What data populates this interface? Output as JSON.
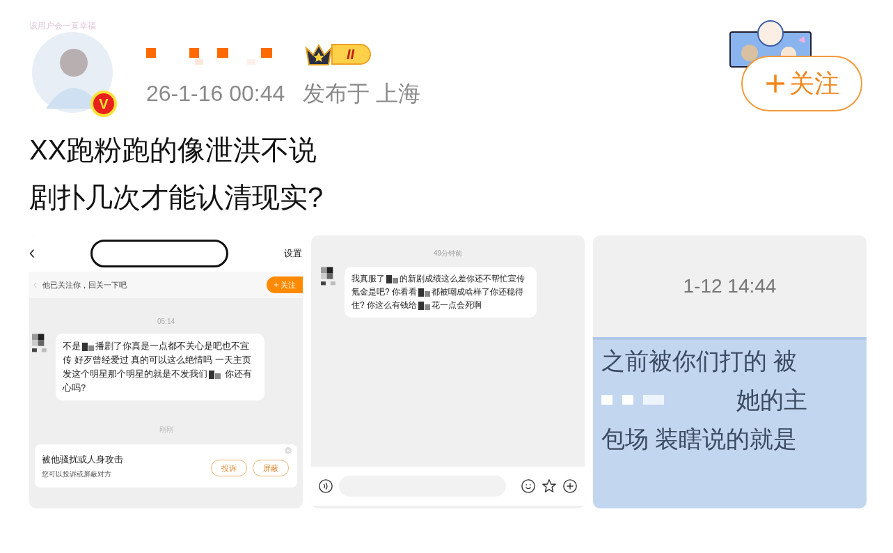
{
  "post": {
    "avatar_frame_text": "该用户会一直幸福",
    "verified_mark": "V",
    "level_badge": "II",
    "timestamp": "26-1-16 00:44",
    "location": "发布于 上海",
    "follow_label": "关注",
    "body": [
      "XX跑粉跑的像泄洪不说",
      "剧扑几次才能认清现实?"
    ]
  },
  "images": [
    {
      "kind": "dm_screen",
      "settings": "设置",
      "banner": "他已关注你，回关一下吧",
      "banner_follow": "关注",
      "time": "05:14",
      "message": [
        {
          "kind": "text",
          "text": "不是"
        },
        {
          "kind": "mosaic"
        },
        {
          "kind": "text",
          "text": "播剧了你真是一点都不关心是吧也不宣传 好歹曾经爱过 真的可以这么绝情吗 一天主页发这个明星那个明星的就是不发我们"
        },
        {
          "kind": "mosaic"
        },
        {
          "kind": "text",
          "text": " 你还有心吗?"
        }
      ],
      "time2": "刚刚",
      "notice_title": "被他骚扰或人身攻击",
      "notice_sub": "您可以投诉或屏蔽对方",
      "notice_buttons": [
        "投诉",
        "屏蔽"
      ]
    },
    {
      "kind": "chat_screen",
      "time": "49分钟前",
      "message": [
        {
          "kind": "text",
          "text": "我真服了"
        },
        {
          "kind": "mosaic"
        },
        {
          "kind": "text",
          "text": "的新剧成绩这么差你还不帮忙宣传氪金是吧? 你看看"
        },
        {
          "kind": "mosaic"
        },
        {
          "kind": "text",
          "text": "都被嘲成啥样了你还稳得住? 你这么有钱给"
        },
        {
          "kind": "mosaic"
        },
        {
          "kind": "text",
          "text": "花一点会死啊"
        }
      ]
    },
    {
      "kind": "highlight_screen",
      "time": "1-12 14:44",
      "lines": [
        {
          "kind": "text",
          "text": "之前被你们打的 被"
        },
        {
          "kind": "mosaic_text",
          "text": "她的主"
        },
        {
          "kind": "text",
          "text": "包场 装瞎说的就是"
        }
      ]
    }
  ]
}
